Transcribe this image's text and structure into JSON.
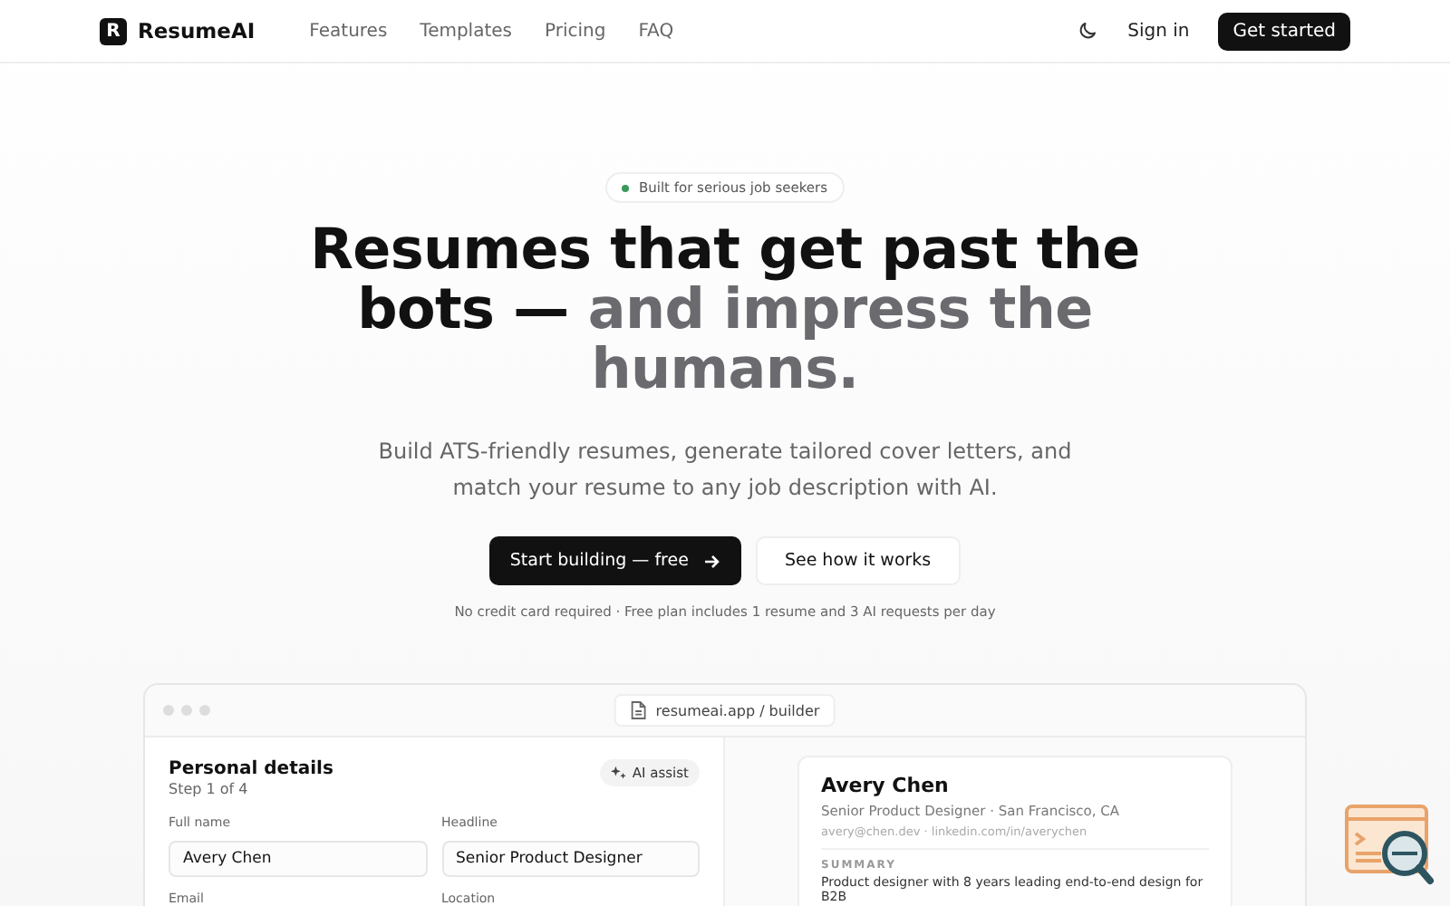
{
  "nav": {
    "brand": {
      "mark": "R",
      "name": "ResumeAI"
    },
    "links": [
      "Features",
      "Templates",
      "Pricing",
      "FAQ"
    ],
    "sign_in": "Sign in",
    "cta": "Get started"
  },
  "hero": {
    "badge": "Built for serious job seekers",
    "title_dark": "Resumes that get past the bots —",
    "title_muted": "and impress the humans.",
    "subtitle": "Build ATS-friendly resumes, generate tailored cover letters, and match your resume to any job description with AI.",
    "primary": "Start building — free",
    "secondary": "See how it works",
    "note": "No credit card required · Free plan includes 1 resume and 3 AI requests per day"
  },
  "preview": {
    "url": "resumeai.app / builder",
    "form": {
      "title": "Personal details",
      "step": "Step 1 of 4",
      "assist": "AI assist",
      "fields": [
        {
          "label": "Full name",
          "value": "Avery Chen"
        },
        {
          "label": "Headline",
          "value": "Senior Product Designer"
        },
        {
          "label": "Email"
        },
        {
          "label": "Location"
        }
      ]
    },
    "resume": {
      "name": "Avery Chen",
      "line": "Senior Product Designer · San Francisco, CA",
      "contact": "avery@chen.dev · linkedin.com/in/averychen",
      "section": "SUMMARY",
      "summary": "Product designer with 8 years leading end-to-end design for B2B"
    }
  }
}
